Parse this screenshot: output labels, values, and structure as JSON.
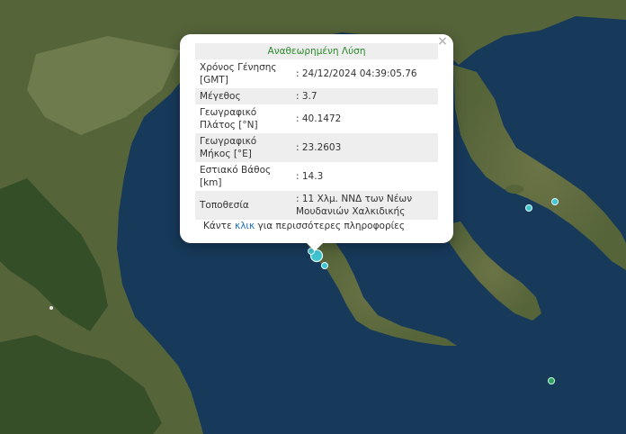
{
  "popup": {
    "title": "Αναθεωρημένη Λύση",
    "close_symbol": "×",
    "rows": [
      {
        "label": "Χρόνος Γένησης [GMT]",
        "value": ": 24/12/2024 04:39:05.76"
      },
      {
        "label": "Μέγεθος",
        "value": ": 3.7"
      },
      {
        "label": "Γεωγραφικό Πλάτος [°N]",
        "value": ": 40.1472"
      },
      {
        "label": "Γεωγραφικό Μήκος [°E]",
        "value": ": 23.2603"
      },
      {
        "label": "Εστιακό Βάθος [km]",
        "value": ": 14.3"
      },
      {
        "label": "Τοποθεσία",
        "value": ": 11 Χλμ. ΝΝΔ των Νέων Μουδανιών Χαλκιδικής"
      }
    ],
    "footer_pre": "Κάντε ",
    "footer_link": "κλικ",
    "footer_post": " για περισσότερες πληροφορίες"
  },
  "map": {
    "colors": {
      "sea": "#17395a",
      "land": "#56643a",
      "dark_forest": "#2e4a24",
      "pale_land": "#7e8a58",
      "marker_cyan": "#3ec5d2",
      "marker_green": "#2fa060"
    }
  }
}
